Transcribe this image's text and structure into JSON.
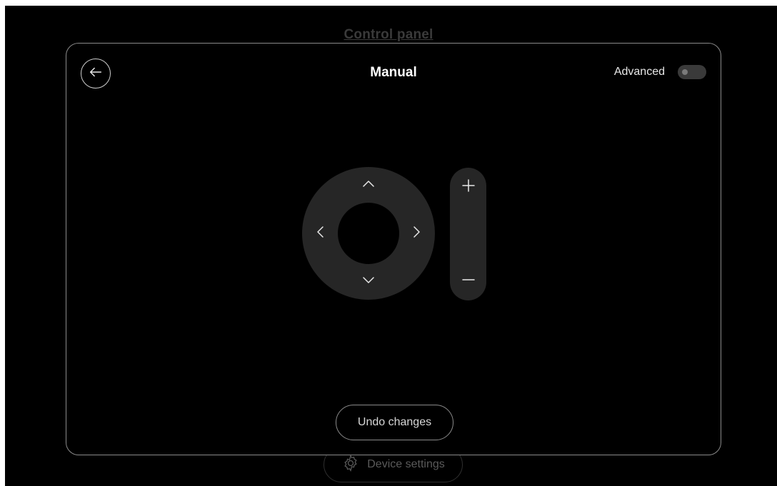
{
  "background": {
    "title": "Control panel",
    "device_settings_label": "Device settings",
    "device_settings_icon": "gear-icon"
  },
  "dialog": {
    "title": "Manual",
    "back_icon": "arrow-left-icon",
    "advanced_label": "Advanced",
    "advanced_enabled": false,
    "undo_label": "Undo changes"
  },
  "camera_controls": {
    "dpad_icons": [
      "chevron-up-icon",
      "chevron-down-icon",
      "chevron-left-icon",
      "chevron-right-icon"
    ],
    "zoom_icons": [
      "plus-icon",
      "minus-icon"
    ]
  },
  "colors": {
    "background": "#000000",
    "border": "#8a8a8a",
    "control_fill": "#262626",
    "text": "#e8e8e8"
  }
}
